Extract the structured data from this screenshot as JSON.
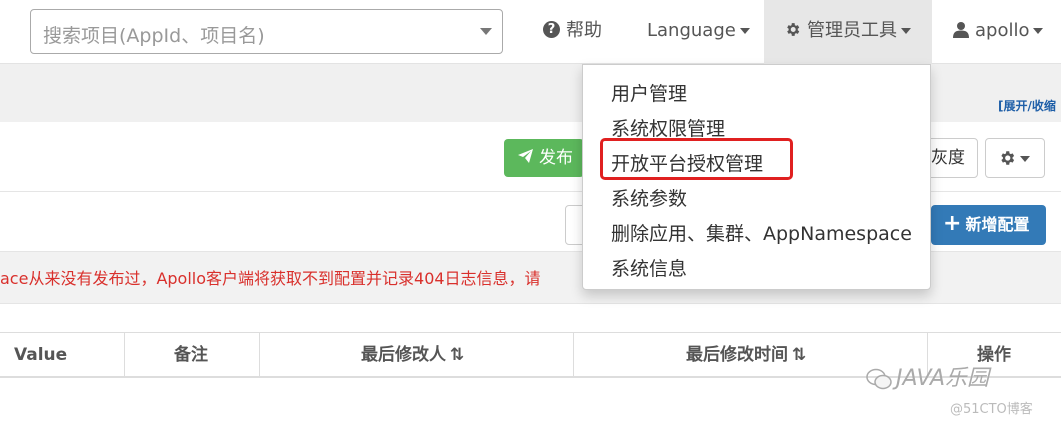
{
  "navbar": {
    "search_placeholder": "搜索项目(AppId、项目名)",
    "help_label": "帮助",
    "language_label": "Language",
    "admin_tools_label": "管理员工具",
    "user_label": "apollo"
  },
  "admin_menu": {
    "items": [
      "用户管理",
      "系统权限管理",
      "开放平台授权管理",
      "系统参数",
      "删除应用、集群、AppNamespace",
      "系统信息"
    ],
    "highlighted_index": 2,
    "highlight_color": "#e02020"
  },
  "page": {
    "expand_collapse_label": "[展开/收缩",
    "publish_label": "发布",
    "gray_label": "灰度",
    "add_config_label": "新增配置",
    "warning_text": "ace从来没有发布过，Apollo客户端将获取不到配置并记录404日志信息，请",
    "warning_color": "#d9302c",
    "publish_color": "#5cb85c",
    "primary_color": "#337ab7"
  },
  "table": {
    "columns": [
      "Value",
      "备注",
      "最后修改人",
      "最后修改时间",
      "操作"
    ],
    "sort_glyph": "⇅"
  },
  "watermark": {
    "main": "JAVA乐园",
    "sub": "@51CTO博客"
  }
}
